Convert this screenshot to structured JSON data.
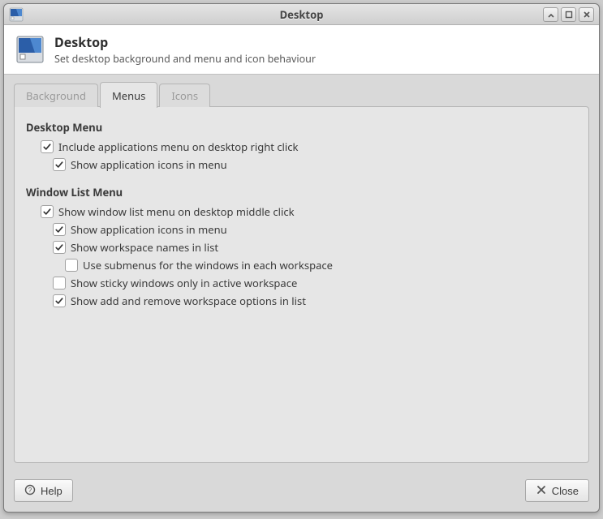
{
  "window": {
    "title": "Desktop"
  },
  "header": {
    "title": "Desktop",
    "subtitle": "Set desktop background and menu and icon behaviour"
  },
  "tabs": {
    "background": "Background",
    "menus": "Menus",
    "icons": "Icons"
  },
  "sections": {
    "desktop_menu": {
      "title": "Desktop Menu",
      "include_apps": {
        "label": "Include applications menu on desktop right click",
        "checked": true
      },
      "show_icons": {
        "label": "Show application icons in menu",
        "checked": true
      }
    },
    "window_list_menu": {
      "title": "Window List Menu",
      "show_window_list": {
        "label": "Show window list menu on desktop middle click",
        "checked": true
      },
      "show_app_icons": {
        "label": "Show application icons in menu",
        "checked": true
      },
      "show_workspace_names": {
        "label": "Show workspace names in list",
        "checked": true
      },
      "use_submenus": {
        "label": "Use submenus for the windows in each workspace",
        "checked": false
      },
      "sticky_active": {
        "label": "Show sticky windows only in active workspace",
        "checked": false
      },
      "show_add_remove": {
        "label": "Show add and remove workspace options in list",
        "checked": true
      }
    }
  },
  "footer": {
    "help": "Help",
    "close": "Close"
  }
}
